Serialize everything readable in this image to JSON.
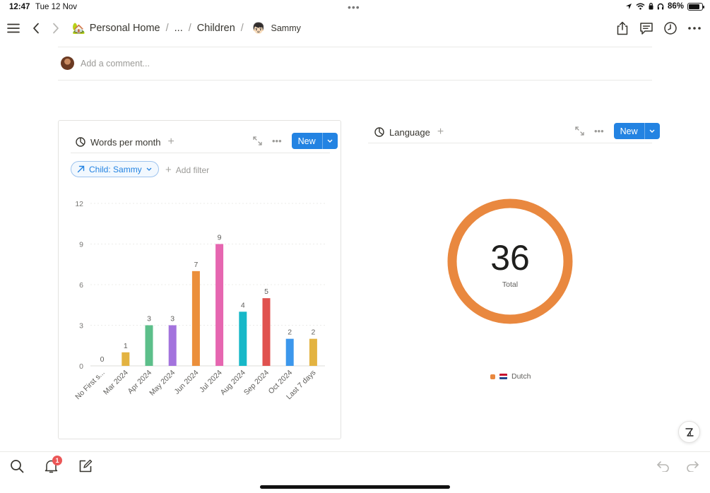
{
  "status": {
    "time": "12:47",
    "date": "Tue 12 Nov",
    "battery": "86%",
    "battery_level": 0.86
  },
  "breadcrumb": {
    "home_label": "Personal Home",
    "ellipsis": "...",
    "parent_label": "Children",
    "current_label": "Sammy",
    "separator": "/"
  },
  "comment": {
    "placeholder": "Add a comment..."
  },
  "words_card": {
    "title": "Words per month",
    "new_label": "New",
    "filter_chip": "Child: Sammy",
    "add_filter": "Add filter"
  },
  "language_card": {
    "title": "Language",
    "new_label": "New",
    "total_value": "36",
    "total_label": "Total",
    "legend_label": "Dutch"
  },
  "notifications": {
    "badge": "1"
  },
  "colors": {
    "accent": "#2383e2",
    "donut": "#e9883f"
  },
  "chart_data": [
    {
      "type": "bar",
      "categories": [
        "No First s...",
        "Mar 2024",
        "Apr 2024",
        "May 2024",
        "Jun 2024",
        "Jul 2024",
        "Aug 2024",
        "Sep 2024",
        "Oct 2024",
        "Last 7 days"
      ],
      "values": [
        0,
        1,
        3,
        3,
        7,
        9,
        4,
        5,
        2,
        2
      ],
      "colors": [
        "#e3b341",
        "#e3b341",
        "#5cbf8a",
        "#a373dd",
        "#eb8f3b",
        "#e666b0",
        "#17b8c8",
        "#e0524f",
        "#3c97ec",
        "#e3b341"
      ],
      "ylim": [
        0,
        12
      ],
      "yticks": [
        0,
        3,
        6,
        9,
        12
      ],
      "grid": true,
      "data_labels": true
    },
    {
      "type": "pie",
      "variant": "donut",
      "slices": [
        {
          "label": "Dutch",
          "value": 36,
          "color": "#e9883f"
        }
      ],
      "center_value": "36",
      "center_label": "Total",
      "legend": "bottom"
    }
  ]
}
